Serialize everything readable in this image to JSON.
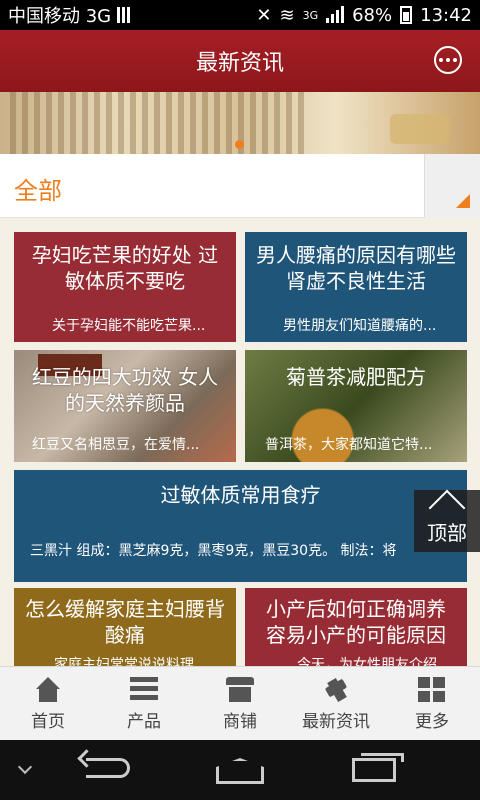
{
  "status_bar": {
    "carrier": "中国移动 3G",
    "network": "3G",
    "battery": "68%",
    "time": "13:42"
  },
  "app_bar": {
    "title": "最新资讯"
  },
  "filter": {
    "selected": "全部"
  },
  "articles": [
    {
      "title": "孕妇吃芒果的好处 过敏体质不要吃",
      "summary": "关于孕妇能不能吃芒果..."
    },
    {
      "title": "男人腰痛的原因有哪些 肾虚不良性生活",
      "summary": "男性朋友们知道腰痛的..."
    },
    {
      "title": "红豆的四大功效 女人的天然养颜品",
      "summary": "红豆又名相思豆，在爱情..."
    },
    {
      "title": "菊普茶减肥配方",
      "summary": "普洱茶，大家都知道它特..."
    },
    {
      "title": "过敏体质常用食疗",
      "summary": "三黑汁 组成：黑芝麻9克，黑枣9克，黑豆30克。 制法：将"
    },
    {
      "title": "怎么缓解家庭主妇腰背酸痛",
      "summary": "家庭主妇常常说说料理"
    },
    {
      "title": "小产后如何正确调养 容易小产的可能原因",
      "summary": "今天，为女性朋友介绍"
    }
  ],
  "back_to_top": "顶部",
  "tab_bar": {
    "items": [
      {
        "label": "首页",
        "icon": "home-icon"
      },
      {
        "label": "产品",
        "icon": "list-icon"
      },
      {
        "label": "商铺",
        "icon": "shop-icon"
      },
      {
        "label": "最新资讯",
        "icon": "news-icon"
      },
      {
        "label": "更多",
        "icon": "more-icon"
      }
    ]
  },
  "colors": {
    "app_bar": "#a51f24",
    "accent": "#ee7f1e",
    "card_red": "#982c35",
    "card_blue": "#20557a",
    "card_brown": "#8f6a1a"
  }
}
